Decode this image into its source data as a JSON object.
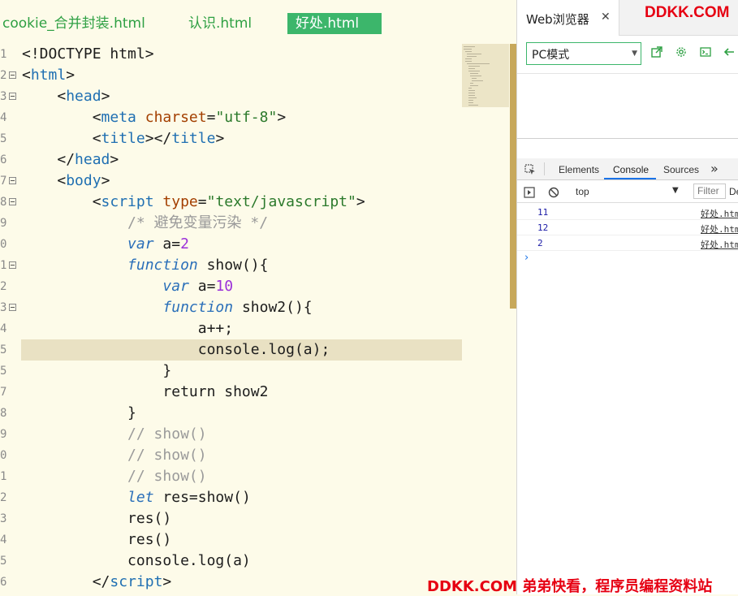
{
  "editor": {
    "tabs": [
      {
        "label": "cookie_合并封装.html",
        "active": false
      },
      {
        "label": "认识.html",
        "active": false
      },
      {
        "label": "好处.html",
        "active": true
      }
    ],
    "line_numbers": [
      "1",
      "2",
      "3",
      "4",
      "5",
      "6",
      "7",
      "8",
      "9",
      "0",
      "1",
      "2",
      "3",
      "4",
      "5",
      "5",
      "7",
      "8",
      "9",
      "0",
      "1",
      "2",
      "3",
      "4",
      "5",
      "6"
    ],
    "current_line_index": 14
  },
  "browser": {
    "tab_title": "Web浏览器",
    "brand": "DDKK.COM",
    "mode": "PC模式",
    "devtools": {
      "tabs": [
        "Elements",
        "Console",
        "Sources"
      ],
      "active_tab": "Console",
      "context": "top",
      "filter_placeholder": "Filter",
      "de_label": "De",
      "logs": [
        {
          "value": "11",
          "source": "好处.htm"
        },
        {
          "value": "12",
          "source": "好处.htm"
        },
        {
          "value": "2",
          "source": "好处.htm"
        }
      ]
    }
  },
  "footer": "DDKK.COM 弟弟快看，程序员编程资料站"
}
